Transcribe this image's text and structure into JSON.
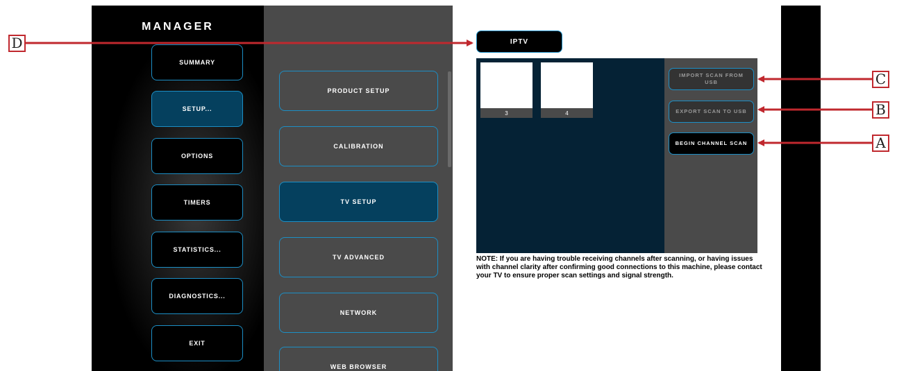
{
  "manager": {
    "title": "MANAGER",
    "nav": [
      {
        "label": "SUMMARY",
        "active": false
      },
      {
        "label": "SETUP...",
        "active": true
      },
      {
        "label": "OPTIONS",
        "active": false
      },
      {
        "label": "TIMERS",
        "active": false
      },
      {
        "label": "STATISTICS...",
        "active": false
      },
      {
        "label": "DIAGNOSTICS...",
        "active": false
      },
      {
        "label": "EXIT",
        "active": false
      }
    ]
  },
  "submenu": {
    "items": [
      {
        "label": "PRODUCT SETUP",
        "active": false
      },
      {
        "label": "CALIBRATION",
        "active": false
      },
      {
        "label": "TV SETUP",
        "active": true
      },
      {
        "label": "TV ADVANCED",
        "active": false
      },
      {
        "label": "NETWORK",
        "active": false
      },
      {
        "label": "WEB BROWSER",
        "active": false
      }
    ]
  },
  "content": {
    "tab_label": "IPTV",
    "channels": [
      {
        "number": "3"
      },
      {
        "number": "4"
      }
    ],
    "actions": {
      "import_label": "IMPORT SCAN FROM USB",
      "export_label": "EXPORT SCAN TO USB",
      "begin_label": "BEGIN CHANNEL SCAN"
    },
    "note": "NOTE: If you are having trouble receiving channels after scanning, or having issues with channel clarity after confirming good connections to this machine, please contact your TV to ensure proper scan settings and signal strength."
  },
  "callouts": {
    "d": "D",
    "c": "C",
    "b": "B",
    "a": "A"
  },
  "colors": {
    "accent_border": "#1c8fc6",
    "active_fill": "#05405e",
    "callout_red": "#c0282e"
  }
}
